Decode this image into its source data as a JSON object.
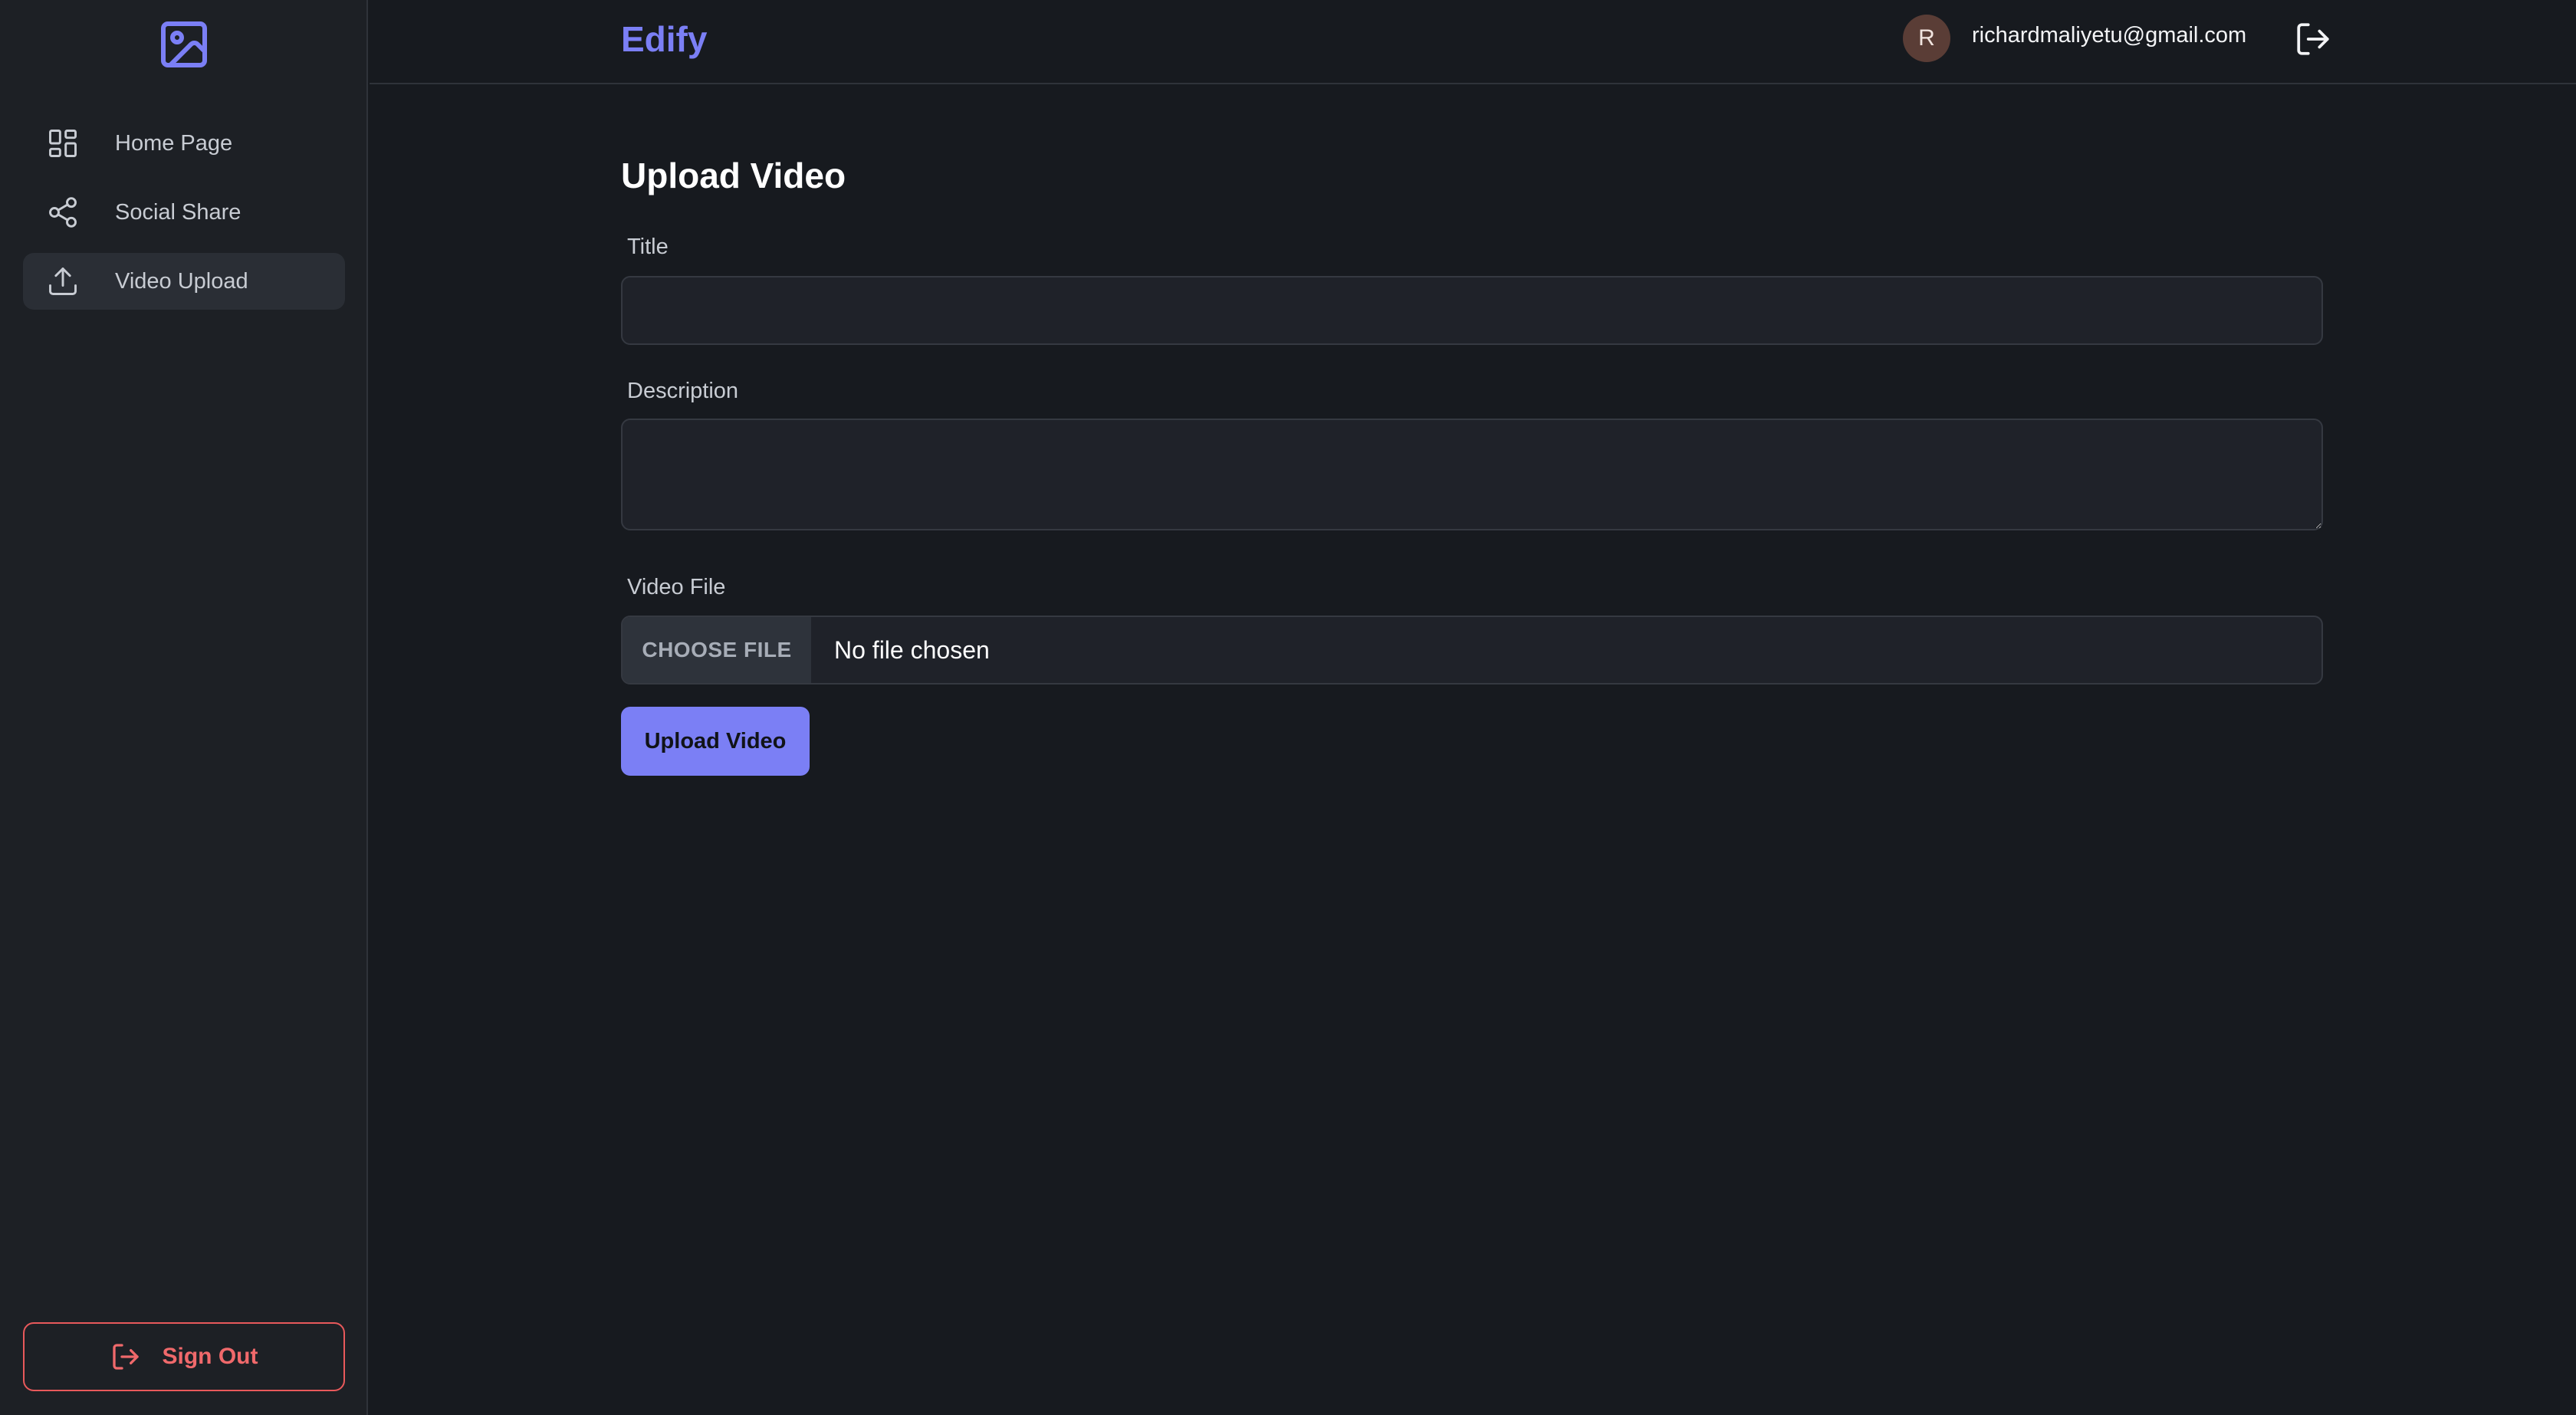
{
  "app": {
    "name": "Edify"
  },
  "sidebar": {
    "items": [
      {
        "label": "Home Page",
        "icon": "dashboard-grid-icon",
        "active": false
      },
      {
        "label": "Social Share",
        "icon": "share-icon",
        "active": false
      },
      {
        "label": "Video Upload",
        "icon": "upload-icon",
        "active": true
      }
    ],
    "sign_out_label": "Sign Out"
  },
  "header": {
    "avatar_initial": "R",
    "user_email": "richardmaliyetu@gmail.com"
  },
  "form": {
    "title": "Upload Video",
    "title_label": "Title",
    "title_value": "",
    "description_label": "Description",
    "description_value": "",
    "file_label": "Video File",
    "choose_file_label": "CHOOSE FILE",
    "file_status": "No file chosen",
    "submit_label": "Upload Video"
  },
  "colors": {
    "accent": "#7b7ff5",
    "danger": "#f0696b",
    "background": "#171a1f",
    "sidebar": "#1d2025"
  }
}
